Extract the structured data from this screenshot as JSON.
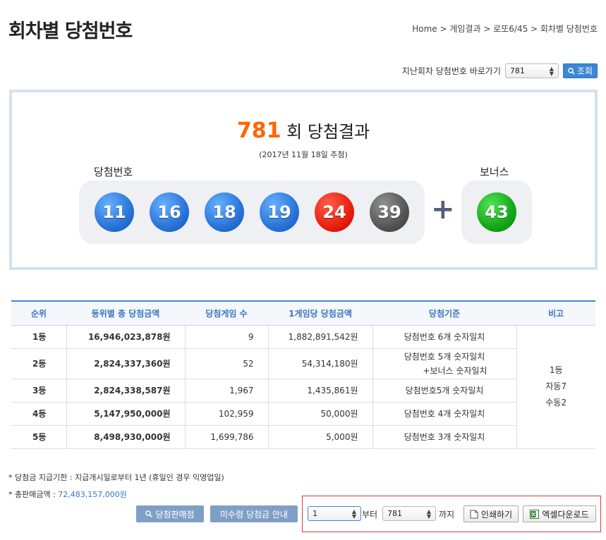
{
  "header": {
    "title": "회차별 당첨번호",
    "breadcrumb": "Home > 게임결과 > 로또6/45 > 회차별 당첨번호"
  },
  "goto": {
    "label": "지난회차 당첨번호 바로가기",
    "selected_round": "781",
    "search_label": "조회"
  },
  "result": {
    "round": "781",
    "round_suffix": "회 당첨결과",
    "draw_date": "(2017년 11월 18일 추첨)",
    "win_label": "당첨번호",
    "bonus_label": "보너스",
    "plus": "+",
    "numbers": [
      "11",
      "16",
      "18",
      "19",
      "24",
      "39"
    ],
    "bonus": "43",
    "ball_colors": [
      "#2a74d8",
      "#2a74d8",
      "#2a74d8",
      "#2a74d8",
      "#e8200e",
      "#555555"
    ],
    "bonus_color": "#15a71a"
  },
  "table": {
    "headers": [
      "순위",
      "등위별 총 당첨금액",
      "당첨게임 수",
      "1게임당 당첨금액",
      "당첨기준",
      "비고"
    ],
    "rows": [
      {
        "rank": "1등",
        "total": "16,946,023,878원",
        "games": "9",
        "per_game": "1,882,891,542원",
        "criteria": "당첨번호 6개 숫자일치",
        "criteria2": ""
      },
      {
        "rank": "2등",
        "total": "2,824,337,360원",
        "games": "52",
        "per_game": "54,314,180원",
        "criteria": "당첨번호 5개 숫자일치",
        "criteria2": "+보너스 숫자일치"
      },
      {
        "rank": "3등",
        "total": "2,824,338,587원",
        "games": "1,967",
        "per_game": "1,435,861원",
        "criteria": "당첨번호5개 숫자일치",
        "criteria2": ""
      },
      {
        "rank": "4등",
        "total": "5,147,950,000원",
        "games": "102,959",
        "per_game": "50,000원",
        "criteria": "당첨번호 4개 숫자일치",
        "criteria2": ""
      },
      {
        "rank": "5등",
        "total": "8,498,930,000원",
        "games": "1,699,786",
        "per_game": "5,000원",
        "criteria": "당첨번호 3개 숫자일치",
        "criteria2": ""
      }
    ],
    "note_lines": [
      "1등",
      "자동7",
      "수동2"
    ]
  },
  "footer": {
    "deadline": "* 당첨금 지급기한 : 지급개시일로부터 1년 (휴일인 경우 익영업일)",
    "sales_label": "* 총판매금액 : ",
    "sales_value": "72,483,157,000원"
  },
  "actions": {
    "store_button": "당첨판매점",
    "unclaimed_button": "미수령 당첨금 안내",
    "from_value": "1",
    "from_suffix": "부터",
    "to_value": "781",
    "to_suffix": "까지",
    "print_button": "인쇄하기",
    "excel_button": "엑셀다운로드"
  }
}
